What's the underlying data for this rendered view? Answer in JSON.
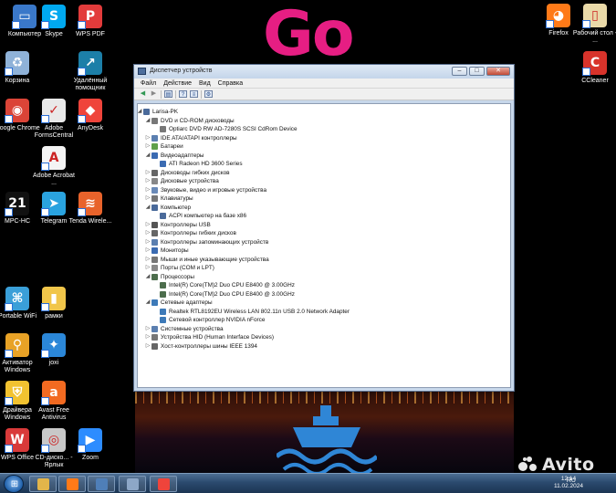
{
  "wallpaper": {
    "logo_text": "Go"
  },
  "desktop": {
    "left_icons": [
      {
        "label": "Компьютер",
        "icon": "computer-icon",
        "color": "#3a78c9"
      },
      {
        "label": "Skype",
        "icon": "skype-icon",
        "color": "#00a9f0"
      },
      {
        "label": "WPS PDF",
        "icon": "wps-pdf-icon",
        "color": "#e23b3b"
      },
      {
        "label": "Корзина",
        "icon": "recycle-bin-icon",
        "color": "#8fb2d8"
      },
      {
        "label": "Удалённый помощник",
        "icon": "remote-assistant-icon",
        "color": "#1c7fa8"
      },
      {
        "label": "Google Chrome",
        "icon": "chrome-icon",
        "color": "#db4437"
      },
      {
        "label": "Adobe FormsCentral",
        "icon": "forms-central-icon",
        "color": "#e9e9e9"
      },
      {
        "label": "AnyDesk",
        "icon": "anydesk-icon",
        "color": "#ef443b"
      },
      {
        "label": "Adobe Acrobat ...",
        "icon": "acrobat-icon",
        "color": "#f4f4f4"
      },
      {
        "label": "MPC-HC",
        "icon": "mpc-hc-icon",
        "color": "#111111"
      },
      {
        "label": "Telegram",
        "icon": "telegram-icon",
        "color": "#2aa3df"
      },
      {
        "label": "Tenda Wirele...",
        "icon": "tenda-wireless-icon",
        "color": "#e8632b"
      },
      {
        "label": "Portable WiFi",
        "icon": "portable-wifi-icon",
        "color": "#3a9fd8"
      },
      {
        "label": "рамки",
        "icon": "folder-icon",
        "color": "#f1c64a"
      },
      {
        "label": "Активатор Windows",
        "icon": "activator-icon",
        "color": "#e8a226"
      },
      {
        "label": "joxi",
        "icon": "joxi-icon",
        "color": "#2b87d8"
      },
      {
        "label": "Драйвера Windows",
        "icon": "drivers-shield-icon",
        "color": "#f2c230"
      },
      {
        "label": "Avast Free Antivirus",
        "icon": "avast-icon",
        "color": "#f26a21"
      },
      {
        "label": "WPS Office",
        "icon": "wps-office-icon",
        "color": "#d93a3a"
      },
      {
        "label": "CD-диско... - Ярлык",
        "icon": "cd-drive-icon",
        "color": "#c8c8c8"
      },
      {
        "label": "Zoom",
        "icon": "zoom-icon",
        "color": "#2d8cff"
      }
    ],
    "right_icons": [
      {
        "label": "Firefox",
        "icon": "firefox-icon",
        "color": "#ff7a18"
      },
      {
        "label": "Рабочий стол - ...",
        "icon": "desktop-folder-icon",
        "color": "#e9d9a8"
      },
      {
        "label": "CCleaner",
        "icon": "ccleaner-icon",
        "color": "#d8332b"
      }
    ]
  },
  "window": {
    "title": "Диспетчер устройств",
    "controls": {
      "minimize": "–",
      "maximize": "□",
      "close": "✕"
    },
    "menu": [
      "Файл",
      "Действие",
      "Вид",
      "Справка"
    ],
    "toolbar": [
      "back-icon",
      "forward-icon",
      "view-icon",
      "help-icon",
      "properties-icon",
      "scan-icon"
    ],
    "tree": [
      {
        "text": "Larisa-PK",
        "level": 0,
        "expander": "◢",
        "icon": "computer-icon",
        "color": "#4a6a9a"
      },
      {
        "text": "DVD и CD-ROM дисководы",
        "level": 1,
        "expander": "◢",
        "icon": "dvd-drive-icon",
        "color": "#777777"
      },
      {
        "text": "Optiarc DVD RW AD-7280S SCSI CdRom Device",
        "level": 2,
        "expander": "",
        "icon": "dvd-drive-icon",
        "color": "#777777"
      },
      {
        "text": "IDE ATA/ATAPI контроллеры",
        "level": 1,
        "expander": "▷",
        "icon": "ide-controller-icon",
        "color": "#5b7fb0"
      },
      {
        "text": "Батареи",
        "level": 1,
        "expander": "▷",
        "icon": "battery-icon",
        "color": "#5fa04a"
      },
      {
        "text": "Видеоадаптеры",
        "level": 1,
        "expander": "◢",
        "icon": "display-adapter-icon",
        "color": "#3b6bb2"
      },
      {
        "text": "ATI Radeon HD 3600 Series",
        "level": 2,
        "expander": "",
        "icon": "display-adapter-icon",
        "color": "#3b6bb2"
      },
      {
        "text": "Дисководы гибких дисков",
        "level": 1,
        "expander": "▷",
        "icon": "floppy-drive-icon",
        "color": "#666666"
      },
      {
        "text": "Дисковые устройства",
        "level": 1,
        "expander": "▷",
        "icon": "disk-drive-icon",
        "color": "#888888"
      },
      {
        "text": "Звуковые, видео и игровые устройства",
        "level": 1,
        "expander": "▷",
        "icon": "sound-icon",
        "color": "#6a8ab8"
      },
      {
        "text": "Клавиатуры",
        "level": 1,
        "expander": "▷",
        "icon": "keyboard-icon",
        "color": "#777777"
      },
      {
        "text": "Компьютер",
        "level": 1,
        "expander": "◢",
        "icon": "computer-icon",
        "color": "#4a6a9a"
      },
      {
        "text": "ACPI компьютер на базе x86",
        "level": 2,
        "expander": "",
        "icon": "computer-icon",
        "color": "#4a6a9a"
      },
      {
        "text": "Контроллеры USB",
        "level": 1,
        "expander": "▷",
        "icon": "usb-icon",
        "color": "#555555"
      },
      {
        "text": "Контроллеры гибких дисков",
        "level": 1,
        "expander": "▷",
        "icon": "floppy-controller-icon",
        "color": "#666666"
      },
      {
        "text": "Контроллеры запоминающих устройств",
        "level": 1,
        "expander": "▷",
        "icon": "storage-controller-icon",
        "color": "#5b7fb0"
      },
      {
        "text": "Мониторы",
        "level": 1,
        "expander": "▷",
        "icon": "monitor-icon",
        "color": "#3b6bb2"
      },
      {
        "text": "Мыши и иные указывающие устройства",
        "level": 1,
        "expander": "▷",
        "icon": "mouse-icon",
        "color": "#777777"
      },
      {
        "text": "Порты (COM и LPT)",
        "level": 1,
        "expander": "▷",
        "icon": "port-icon",
        "color": "#8a8a8a"
      },
      {
        "text": "Процессоры",
        "level": 1,
        "expander": "◢",
        "icon": "processor-icon",
        "color": "#4c6d4c"
      },
      {
        "text": "Intel(R) Core(TM)2 Duo CPU     E8400  @ 3.00GHz",
        "level": 2,
        "expander": "",
        "icon": "processor-icon",
        "color": "#4c6d4c"
      },
      {
        "text": "Intel(R) Core(TM)2 Duo CPU     E8400  @ 3.00GHz",
        "level": 2,
        "expander": "",
        "icon": "processor-icon",
        "color": "#4c6d4c"
      },
      {
        "text": "Сетевые адаптеры",
        "level": 1,
        "expander": "◢",
        "icon": "network-adapter-icon",
        "color": "#3d7ab8"
      },
      {
        "text": "Realtek RTL8192EU Wireless LAN 802.11n USB 2.0 Network Adapter",
        "level": 2,
        "expander": "",
        "icon": "network-adapter-icon",
        "color": "#3d7ab8"
      },
      {
        "text": "Сетевой контроллер NVIDIA nForce",
        "level": 2,
        "expander": "",
        "icon": "network-adapter-icon",
        "color": "#3d7ab8"
      },
      {
        "text": "Системные устройства",
        "level": 1,
        "expander": "▷",
        "icon": "system-devices-icon",
        "color": "#5b7fb0"
      },
      {
        "text": "Устройства HID (Human Interface Devices)",
        "level": 1,
        "expander": "▷",
        "icon": "hid-icon",
        "color": "#777777"
      },
      {
        "text": "Хост-контроллеры шины IEEE 1394",
        "level": 1,
        "expander": "▷",
        "icon": "ieee1394-icon",
        "color": "#666666"
      }
    ]
  },
  "taskbar": {
    "start_glyph": "⊞",
    "buttons": [
      {
        "icon": "explorer-folder-icon",
        "color": "#e2b54a"
      },
      {
        "icon": "firefox-icon",
        "color": "#ff7a18"
      },
      {
        "icon": "device-manager-icon",
        "color": "#4f7fb8"
      },
      {
        "icon": "calculator-icon",
        "color": "#8da7c7"
      },
      {
        "icon": "anydesk-icon",
        "color": "#ef443b"
      }
    ],
    "tray_lang": "RU",
    "time": "12:14",
    "date": "11.02.2024"
  },
  "watermark": {
    "text": "Avito"
  }
}
